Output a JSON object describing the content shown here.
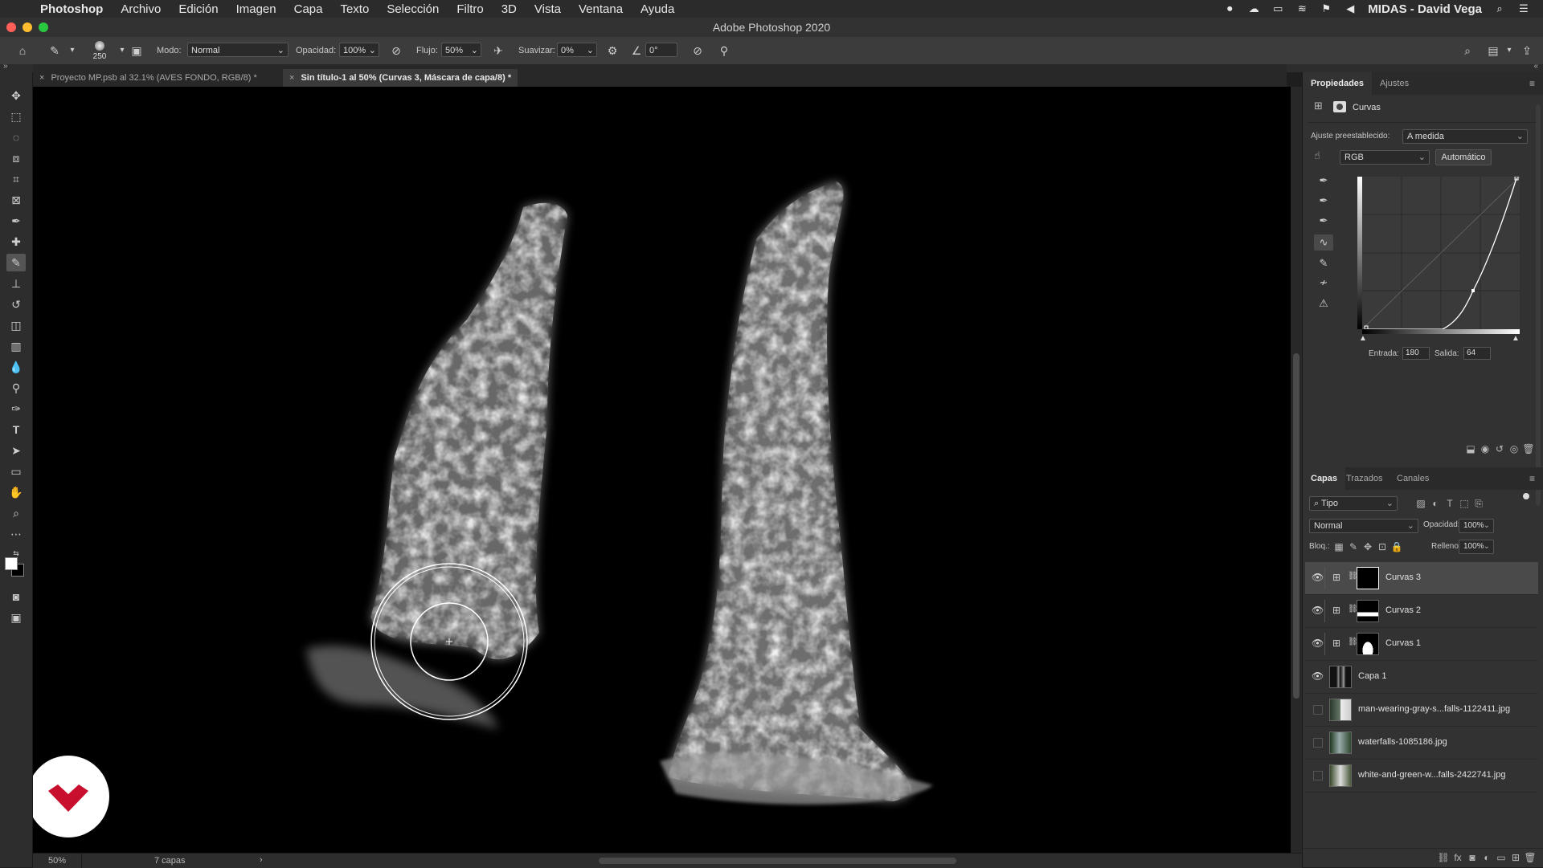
{
  "menubar": {
    "app": "Photoshop",
    "items": [
      "Archivo",
      "Edición",
      "Imagen",
      "Capa",
      "Texto",
      "Selección",
      "Filtro",
      "3D",
      "Vista",
      "Ventana",
      "Ayuda"
    ],
    "user": "MIDAS - David Vega"
  },
  "window": {
    "title": "Adobe Photoshop 2020"
  },
  "options": {
    "brush_size": "250",
    "mode_label": "Modo:",
    "mode_value": "Normal",
    "opacity_label": "Opacidad:",
    "opacity_value": "100%",
    "flow_label": "Flujo:",
    "flow_value": "50%",
    "smooth_label": "Suavizar:",
    "smooth_value": "0%",
    "angle_value": "0°"
  },
  "tabs": [
    {
      "label": "Proyecto MP.psb al 32.1% (AVES FONDO, RGB/8) *"
    },
    {
      "label": "Sin título-1 al 50% (Curvas 3, Máscara de capa/8) *"
    }
  ],
  "status": {
    "zoom": "50%",
    "info": "7 capas"
  },
  "properties": {
    "tab_active": "Propiedades",
    "tab_other": "Ajustes",
    "panel_title": "Curvas",
    "preset_label": "Ajuste preestablecido:",
    "preset_value": "A medida",
    "channel_value": "RGB",
    "auto_button": "Automático",
    "input_label": "Entrada:",
    "input_value": "180",
    "output_label": "Salida:",
    "output_value": "64"
  },
  "layers_panel": {
    "tabs": [
      "Capas",
      "Trazados",
      "Canales"
    ],
    "filter_label": "Tipo",
    "blend_mode": "Normal",
    "opacity_label": "Opacidad:",
    "opacity_value": "100%",
    "lock_label": "Bloq.:",
    "fill_label": "Relleno:",
    "fill_value": "100%",
    "layers": [
      {
        "name": "Curvas 3",
        "visible": true,
        "selected": true
      },
      {
        "name": "Curvas 2",
        "visible": true,
        "selected": false
      },
      {
        "name": "Curvas 1",
        "visible": true,
        "selected": false
      },
      {
        "name": "Capa 1",
        "visible": true,
        "selected": false
      },
      {
        "name": "man-wearing-gray-s...falls-1122411.jpg",
        "visible": false,
        "selected": false
      },
      {
        "name": "waterfalls-1085186.jpg",
        "visible": false,
        "selected": false
      },
      {
        "name": "white-and-green-w...falls-2422741.jpg",
        "visible": false,
        "selected": false
      }
    ]
  },
  "colors": {
    "accent_logo": "#c8102e",
    "canvas": "#000000",
    "panel": "#323232"
  }
}
